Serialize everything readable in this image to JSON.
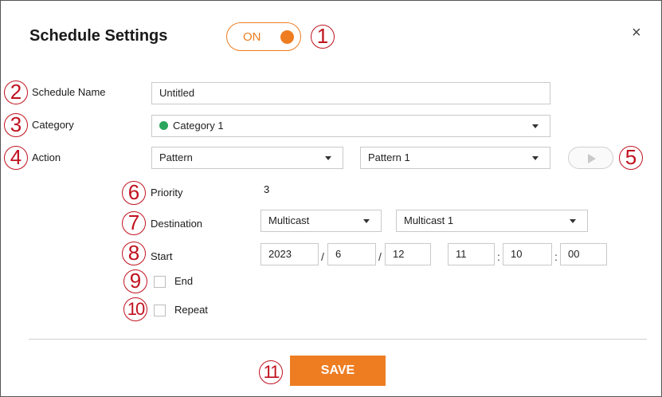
{
  "dialog": {
    "title": "Schedule Settings",
    "toggle_label": "ON",
    "close_glyph": "×",
    "accent_color": "#ee7d22",
    "callout_color": "#c0121f"
  },
  "callouts": [
    "1",
    "2",
    "3",
    "4",
    "5",
    "6",
    "7",
    "8",
    "9",
    "10",
    "11"
  ],
  "fields": {
    "schedule_name": {
      "label": "Schedule Name",
      "value": "Untitled"
    },
    "category": {
      "label": "Category",
      "value": "Category 1",
      "dot_color": "#2aa65c"
    },
    "action": {
      "label": "Action",
      "type_value": "Pattern",
      "pattern_value": "Pattern 1",
      "play_icon": "play-icon"
    },
    "priority": {
      "label": "Priority",
      "value": "3"
    },
    "destination": {
      "label": "Destination",
      "type_value": "Multicast",
      "target_value": "Multicast 1"
    },
    "start": {
      "label": "Start",
      "year": "2023",
      "month": "6",
      "day": "12",
      "hour": "11",
      "minute": "10",
      "second": "00",
      "date_sep": "/",
      "time_sep": ":"
    },
    "end": {
      "label": "End",
      "checked": false
    },
    "repeat": {
      "label": "Repeat",
      "checked": false
    }
  },
  "footer": {
    "save_label": "SAVE"
  }
}
